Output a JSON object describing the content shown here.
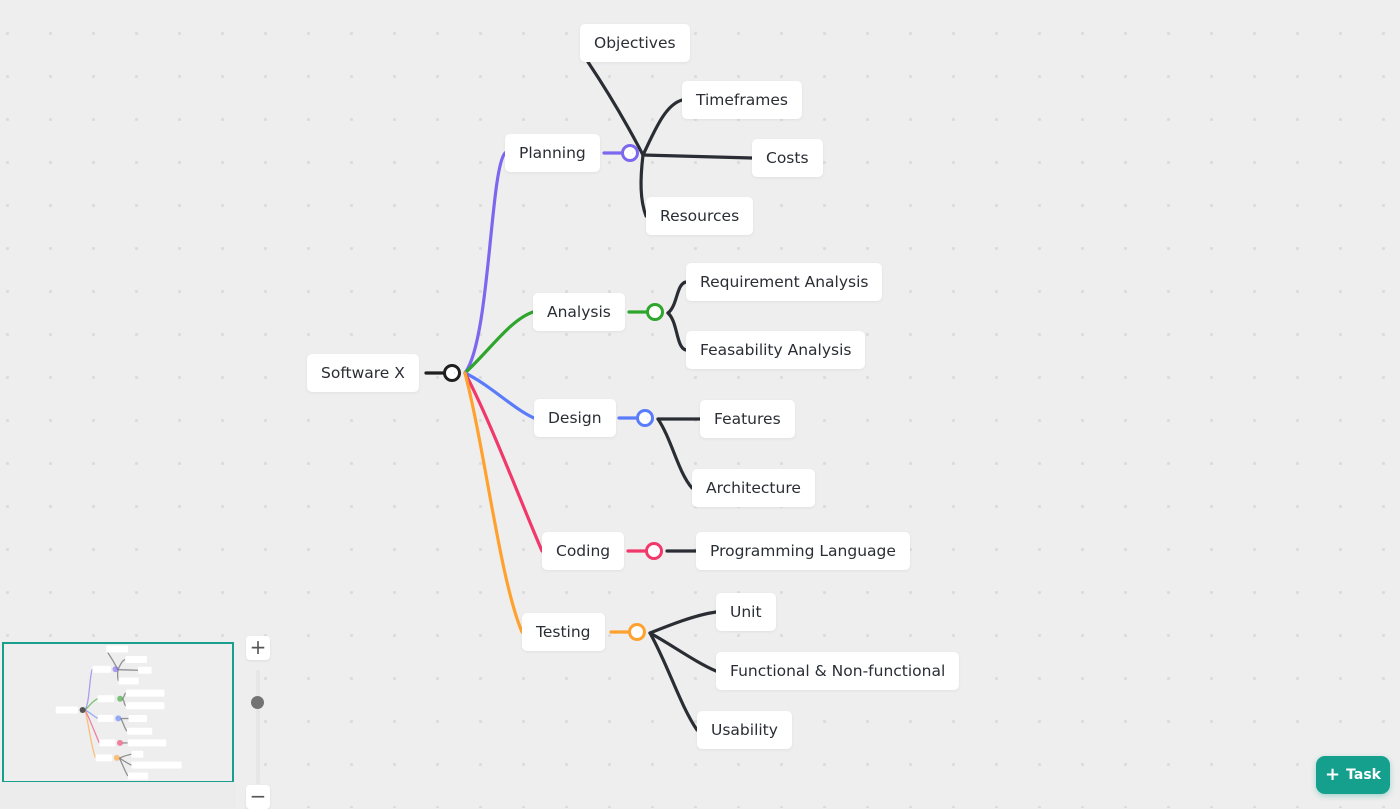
{
  "mindmap": {
    "root": {
      "label": "Software X",
      "color": "#1f1f1f"
    },
    "branches": [
      {
        "label": "Planning",
        "color": "#7b68ee",
        "children": [
          "Objectives",
          "Timeframes",
          "Costs",
          "Resources"
        ]
      },
      {
        "label": "Analysis",
        "color": "#2ea52c",
        "children": [
          "Requirement Analysis",
          "Feasability Analysis"
        ]
      },
      {
        "label": "Design",
        "color": "#5b7cfa",
        "children": [
          "Features",
          "Architecture"
        ]
      },
      {
        "label": "Coding",
        "color": "#f0386b",
        "children": [
          "Programming Language"
        ]
      },
      {
        "label": "Testing",
        "color": "#ffa12f",
        "children": [
          "Unit",
          "Functional & Non-functional",
          "Usability"
        ]
      }
    ],
    "child_link_color": "#2a2e34"
  },
  "controls": {
    "zoom_in_label": "+",
    "zoom_out_label": "−",
    "zoom_in_icon": "plus-icon",
    "zoom_out_icon": "minus-icon"
  },
  "task_button": {
    "label": "Task",
    "icon": "plus-icon",
    "color": "#15a08e"
  },
  "minimap": {
    "frame_color": "#1a9e8d"
  }
}
